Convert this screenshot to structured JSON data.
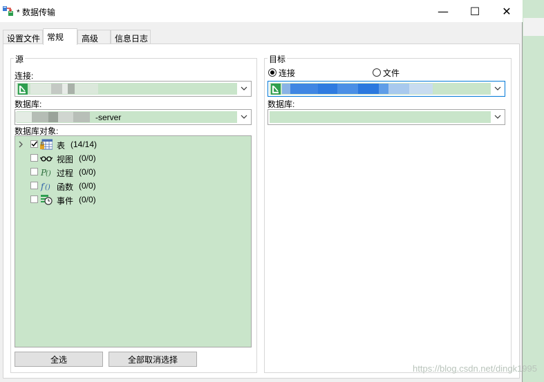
{
  "window": {
    "title": "* 数据传输",
    "controls": {
      "minimize": "—",
      "maximize": "☐",
      "close": "✕"
    }
  },
  "tabs": [
    {
      "label": "设置文件",
      "active": false
    },
    {
      "label": "常规",
      "active": true
    },
    {
      "label": "高级",
      "active": false
    },
    {
      "label": "信息日志",
      "active": false
    }
  ],
  "source": {
    "legend": "源",
    "connection_label": "连接:",
    "connection_value": "",
    "database_label": "数据库:",
    "database_value": "-server",
    "objects_label": "数据库对象:",
    "objects": [
      {
        "icon": "table-icon",
        "label": "表",
        "count": "(14/14)",
        "checked": true,
        "expandable": true
      },
      {
        "icon": "glasses-icon",
        "label": "视图",
        "count": "(0/0)",
        "checked": false,
        "expandable": false
      },
      {
        "icon": "procedure-icon",
        "label": "过程",
        "count": "(0/0)",
        "checked": false,
        "expandable": false
      },
      {
        "icon": "function-icon",
        "label": "函数",
        "count": "(0/0)",
        "checked": false,
        "expandable": false
      },
      {
        "icon": "event-icon",
        "label": "事件",
        "count": "(0/0)",
        "checked": false,
        "expandable": false
      }
    ],
    "select_all": "全选",
    "deselect_all": "全部取消选择"
  },
  "target": {
    "legend": "目标",
    "radio_connection": "连接",
    "radio_file": "文件",
    "selected": "connection",
    "connection_value": "",
    "database_label": "数据库:",
    "database_value": ""
  },
  "watermark": "https://blog.csdn.net/dingk1995",
  "colors": {
    "content_bg": "#c9e5ca",
    "focus_border": "#0078d7"
  }
}
